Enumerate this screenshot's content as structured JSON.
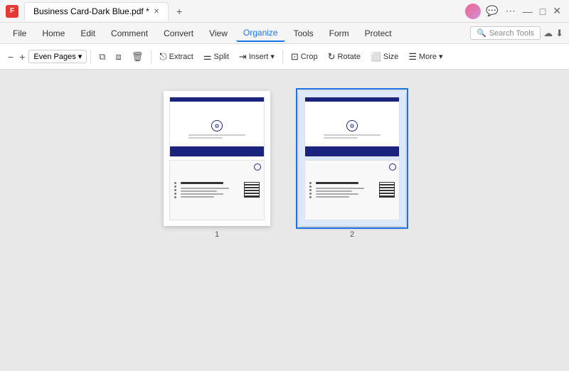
{
  "titlebar": {
    "app_icon": "F",
    "tab_label": "Business Card-Dark Blue.pdf *",
    "new_tab_icon": "+"
  },
  "window_controls": {
    "profile_icon": "👤",
    "chat_icon": "💬",
    "menu_icon": "⋮",
    "minimize": "—",
    "maximize": "□",
    "close": "✕"
  },
  "menubar": {
    "items": [
      {
        "label": "File",
        "active": false
      },
      {
        "label": "Home",
        "active": false
      },
      {
        "label": "Edit",
        "active": false
      },
      {
        "label": "Comment",
        "active": false
      },
      {
        "label": "Convert",
        "active": false
      },
      {
        "label": "View",
        "active": false
      },
      {
        "label": "Organize",
        "active": true
      },
      {
        "label": "Tools",
        "active": false
      },
      {
        "label": "Form",
        "active": false
      },
      {
        "label": "Protect",
        "active": false
      }
    ]
  },
  "toolbar1": {
    "zoom_out": "−",
    "zoom_in": "+",
    "page_filter": "Even Pages",
    "insert_page_icon": "⧉",
    "replace_icon": "⧈",
    "delete_icon": "🗑",
    "extract_label": "Extract",
    "split_label": "Split",
    "insert_label": "Insert",
    "crop_label": "Crop",
    "rotate_label": "Rotate",
    "size_label": "Size",
    "more_label": "More"
  },
  "search_tools": {
    "placeholder": "Search Tools",
    "icon": "🔍"
  },
  "pages": [
    {
      "number": "1",
      "selected": false
    },
    {
      "number": "2",
      "selected": true
    }
  ],
  "colors": {
    "selected_border": "#1a73e8",
    "dark_navy": "#1a237e",
    "menu_active": "#1a73e8"
  }
}
